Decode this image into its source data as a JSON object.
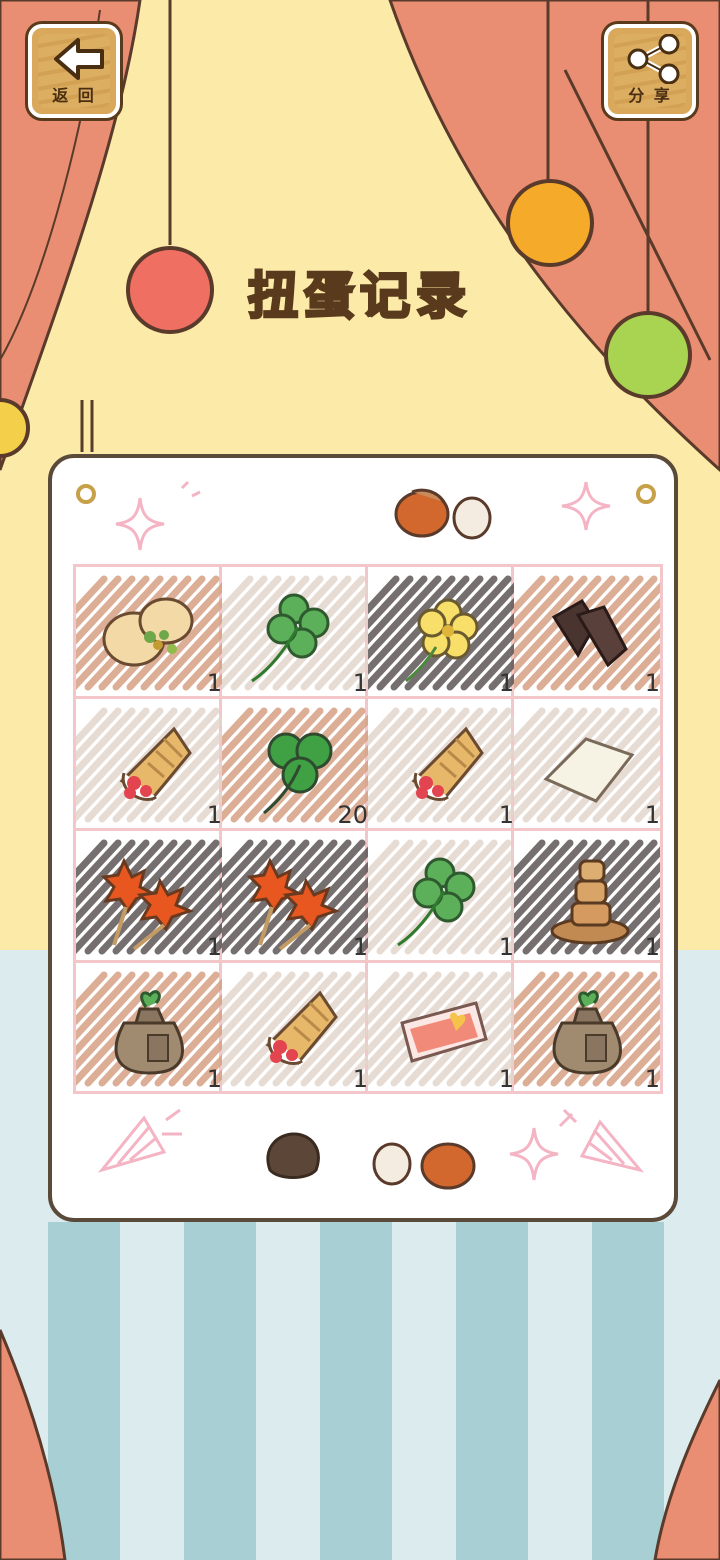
{
  "header": {
    "back_label": "返 回",
    "share_label": "分 享",
    "title": "扭蛋记录"
  },
  "grid": {
    "items": [
      {
        "icon": "bun-icon",
        "count": "1",
        "hatch": "#d6a184"
      },
      {
        "icon": "four-leaf-clover-icon",
        "count": "1",
        "hatch": "#e3d6cc"
      },
      {
        "icon": "yellow-flower-icon",
        "count": "1",
        "hatch": "#5e5656"
      },
      {
        "icon": "dried-meat-icon",
        "count": "1",
        "hatch": "#d6a184"
      },
      {
        "icon": "strawberry-crepe-icon",
        "count": "1",
        "hatch": "#e3d6cc"
      },
      {
        "icon": "three-leaf-clover-icon",
        "count": "20",
        "hatch": "#d6a184"
      },
      {
        "icon": "strawberry-crepe-icon",
        "count": "1",
        "hatch": "#e3d6cc"
      },
      {
        "icon": "paper-sheet-icon",
        "count": "1",
        "hatch": "#e3d6cc"
      },
      {
        "icon": "maple-leaf-tempura-icon",
        "count": "1",
        "hatch": "#5e5656"
      },
      {
        "icon": "maple-leaf-tempura-icon",
        "count": "1",
        "hatch": "#5e5656"
      },
      {
        "icon": "four-leaf-clover-icon",
        "count": "1",
        "hatch": "#e3d6cc"
      },
      {
        "icon": "rock-tower-icon",
        "count": "1",
        "hatch": "#5e5656"
      },
      {
        "icon": "seed-bag-icon",
        "count": "1",
        "hatch": "#d6a184"
      },
      {
        "icon": "strawberry-crepe-icon",
        "count": "1",
        "hatch": "#e3d6cc"
      },
      {
        "icon": "ticket-icon",
        "count": "1",
        "hatch": "#e3d6cc"
      },
      {
        "icon": "seed-bag-icon",
        "count": "1",
        "hatch": "#d6a184"
      }
    ]
  },
  "colors": {
    "curtain": "#e98e72",
    "wall": "#fbeaa8",
    "floor_light": "#dcecee",
    "floor_dark": "#a8d0d4",
    "grid_line": "#f3c6c9"
  }
}
